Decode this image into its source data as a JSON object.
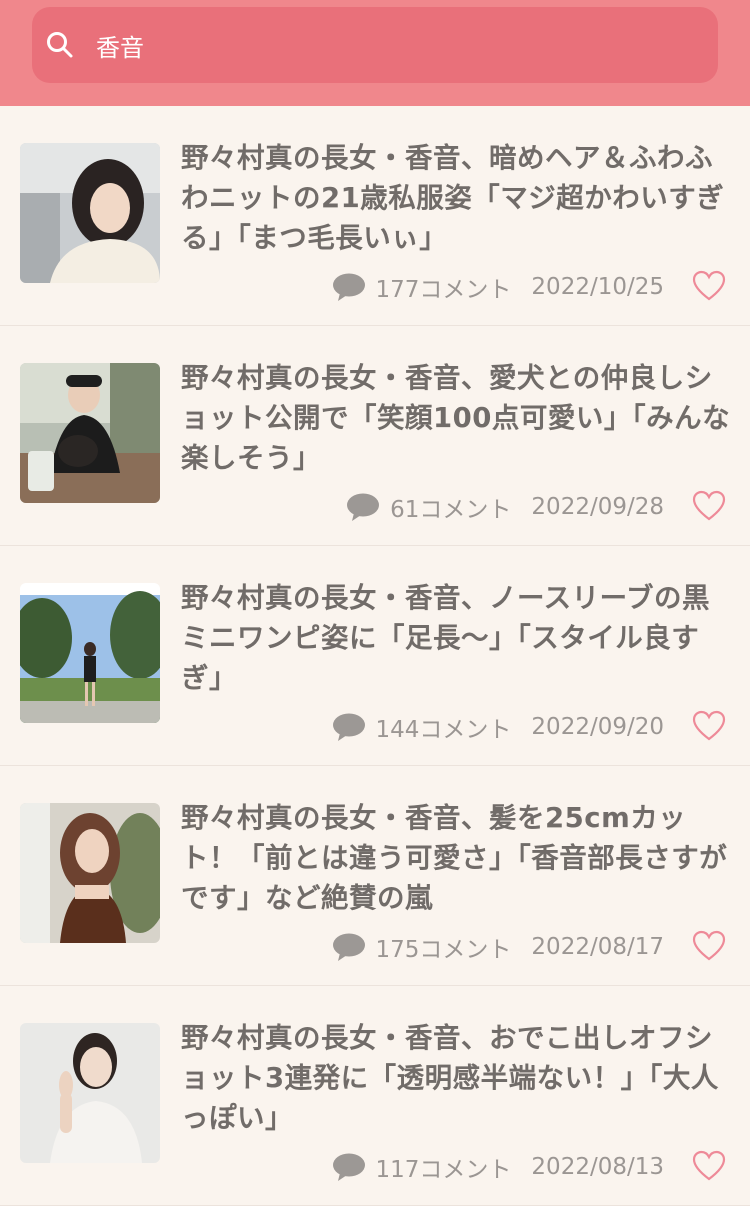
{
  "search": {
    "value": "香音"
  },
  "articles": [
    {
      "title": "野々村真の長女・香音、暗めヘア＆ふわふわニットの21歳私服姿「マジ超かわいすぎる」「まつ毛長いぃ」",
      "comments": "177コメント",
      "date": "2022/10/25"
    },
    {
      "title": "野々村真の長女・香音、愛犬との仲良しショット公開で「笑顔100点可愛い」「みんな楽しそう」",
      "comments": "61コメント",
      "date": "2022/09/28"
    },
    {
      "title": "野々村真の長女・香音、ノースリーブの黒ミニワンピ姿に「足長〜」「スタイル良すぎ」",
      "comments": "144コメント",
      "date": "2022/09/20"
    },
    {
      "title": "野々村真の長女・香音、髪を25cmカット！「前とは違う可愛さ」「香音部長さすがです」など絶賛の嵐",
      "comments": "175コメント",
      "date": "2022/08/17"
    },
    {
      "title": "野々村真の長女・香音、おでこ出しオフショット3連発に「透明感半端ない！」「大人っぽい」",
      "comments": "117コメント",
      "date": "2022/08/13"
    }
  ],
  "colors": {
    "header": "#f0878c",
    "search_bg": "#e9707a",
    "background": "#faf4ee",
    "heart": "#ee8a98"
  },
  "icons": {
    "search": "search-icon",
    "comment": "comment-icon",
    "favorite": "heart-icon"
  }
}
